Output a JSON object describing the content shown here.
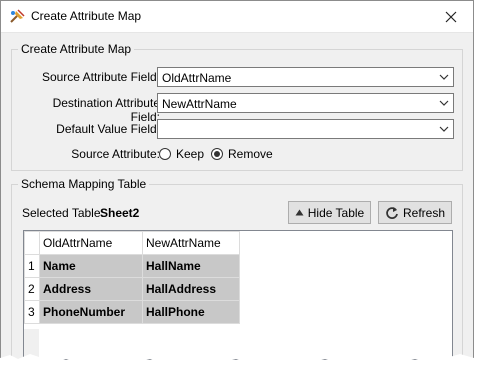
{
  "window": {
    "title": "Create Attribute Map"
  },
  "attribute_map": {
    "group_title": "Create Attribute Map",
    "source_label": "Source Attribute Field:",
    "source_value": "OldAttrName",
    "dest_label": "Destination Attribute Field:",
    "dest_value": "NewAttrName",
    "default_label": "Default Value Field:",
    "default_value": "",
    "source_attr_label": "Source Attribute:",
    "options": [
      {
        "label": "Keep",
        "checked": false
      },
      {
        "label": "Remove",
        "checked": true
      }
    ]
  },
  "schema": {
    "group_title": "Schema Mapping Table",
    "selected_label": "Selected Table:",
    "selected_value": "Sheet2",
    "hide_button": "Hide Table",
    "refresh_button": "Refresh",
    "columns": [
      "OldAttrName",
      "NewAttrName"
    ],
    "rows": [
      {
        "num": "1",
        "old": "Name",
        "new": "HallName"
      },
      {
        "num": "2",
        "old": "Address",
        "new": "HallAddress"
      },
      {
        "num": "3",
        "old": "PhoneNumber",
        "new": "HallPhone"
      }
    ]
  },
  "colors": {
    "window_bg": "#f0f0f0",
    "selected_cell": "#c8c8c8",
    "border": "#7a7a7a"
  }
}
